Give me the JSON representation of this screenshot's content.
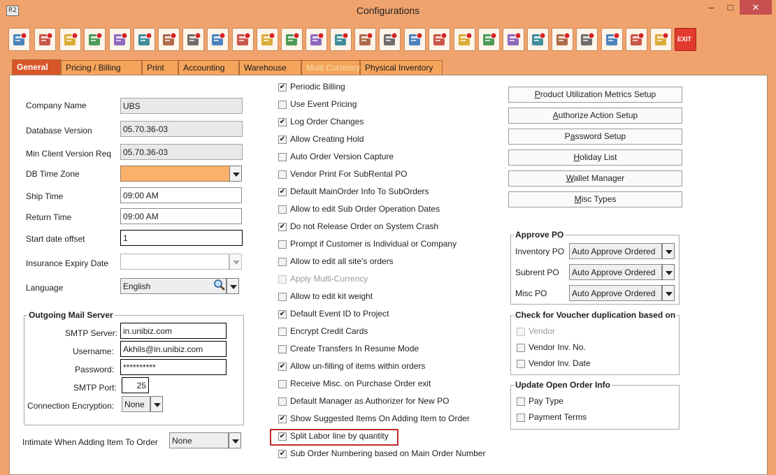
{
  "window": {
    "title": "Configurations",
    "app_icon_text": "R2",
    "minimize": "–",
    "maximize": "□",
    "close": "✕"
  },
  "toolbar": {
    "icons": [
      "save-icon",
      "shipment-icon",
      "money-stack-icon",
      "cash-bill-icon",
      "edit-form-icon",
      "document-alert-icon",
      "price-tag-icon",
      "grid-table-icon",
      "ledger-icon",
      "transfer-icon",
      "calendar-icon",
      "ruler-triangle-icon",
      "gear-icon",
      "color-balls-icon",
      "gear-settings-icon",
      "check-folder-icon",
      "card-reader-icon",
      "doc-export-icon",
      "doc-import-icon",
      "shield-user-icon",
      "shield-lock-icon",
      "gear-cog-icon",
      "document-pages-icon",
      "user-config-icon",
      "folder-settings-icon",
      "form-gear-icon",
      "switch-icon",
      "exit-icon"
    ],
    "exit_label": "EXIT"
  },
  "tabs": [
    {
      "label": "General",
      "state": "active"
    },
    {
      "label": "Pricing / Billing",
      "state": "normal"
    },
    {
      "label": "Print",
      "state": "normal"
    },
    {
      "label": "Accounting",
      "state": "normal"
    },
    {
      "label": "Warehouse",
      "state": "normal"
    },
    {
      "label": "Multi Currency",
      "state": "disabled"
    },
    {
      "label": "Physical Inventory",
      "state": "normal"
    }
  ],
  "general": {
    "company_name_label": "Company Name",
    "company_name": "UBS",
    "database_version_label": "Database Version",
    "database_version": "05.70.36-03",
    "min_client_version_label": "Min Client Version Req",
    "min_client_version": "05.70.36-03",
    "db_time_zone_label": "DB Time Zone",
    "db_time_zone": "",
    "ship_time_label": "Ship Time",
    "ship_time": "09:00 AM",
    "return_time_label": "Return Time",
    "return_time": "09:00 AM",
    "start_date_offset_label": "Start date offset",
    "start_date_offset": "1",
    "insurance_expiry_label": "Insurance Expiry Date",
    "insurance_expiry": "",
    "language_label": "Language",
    "language": "English"
  },
  "mail_server": {
    "title": "Outgoing Mail Server",
    "smtp_server_label": "SMTP Server:",
    "smtp_server": "in.unibiz.com",
    "username_label": "Username:",
    "username": "Akhils@in.unibiz.com",
    "password_label": "Password:",
    "password": "**********",
    "smtp_port_label": "SMTP Port:",
    "smtp_port": "25",
    "encryption_label": "Connection Encryption:",
    "encryption": "None"
  },
  "intimate": {
    "label": "Intimate When Adding Item To Order",
    "value": "None"
  },
  "options": [
    {
      "label": "Periodic Billing",
      "checked": true,
      "disabled": false
    },
    {
      "label": "Use Event Pricing",
      "checked": false,
      "disabled": false
    },
    {
      "label": "Log Order Changes",
      "checked": true,
      "disabled": false
    },
    {
      "label": "Allow Creating Hold",
      "checked": true,
      "disabled": false
    },
    {
      "label": "Auto Order Version Capture",
      "checked": false,
      "disabled": false
    },
    {
      "label": "Vendor Print For SubRental PO",
      "checked": false,
      "disabled": false
    },
    {
      "label": "Default MainOrder Info To SubOrders",
      "checked": true,
      "disabled": false
    },
    {
      "label": "Allow to edit Sub Order Operation Dates",
      "checked": false,
      "disabled": false
    },
    {
      "label": "Do not Release Order on System Crash",
      "checked": true,
      "disabled": false
    },
    {
      "label": "Prompt if Customer is Individual or Company",
      "checked": false,
      "disabled": false
    },
    {
      "label": "Allow to edit all site's orders",
      "checked": false,
      "disabled": false
    },
    {
      "label": "Apply Multi-Currency",
      "checked": false,
      "disabled": true
    },
    {
      "label": "Allow to edit kit weight",
      "checked": false,
      "disabled": false
    },
    {
      "label": "Default Event ID to Project",
      "checked": true,
      "disabled": false
    },
    {
      "label": "Encrypt Credit Cards",
      "checked": false,
      "disabled": false
    },
    {
      "label": "Create Transfers In Resume Mode",
      "checked": false,
      "disabled": false
    },
    {
      "label": "Allow un-filling of items within orders",
      "checked": true,
      "disabled": false
    },
    {
      "label": "Receive Misc. on Purchase Order exit",
      "checked": false,
      "disabled": false
    },
    {
      "label": "Default Manager as Authorizer for New PO",
      "checked": false,
      "disabled": false
    },
    {
      "label": "Show Suggested Items On Adding Item to Order",
      "checked": true,
      "disabled": false
    },
    {
      "label": "Split Labor line by quantity",
      "checked": true,
      "disabled": false
    },
    {
      "label": "Sub Order Numbering based on Main Order Number",
      "checked": true,
      "disabled": false
    }
  ],
  "setup_buttons": [
    {
      "pre": "",
      "u": "P",
      "post": "roduct Utilization Metrics Setup"
    },
    {
      "pre": "",
      "u": "A",
      "post": "uthorize Action Setup"
    },
    {
      "pre": "P",
      "u": "a",
      "post": "ssword Setup"
    },
    {
      "pre": "",
      "u": "H",
      "post": "oliday List"
    },
    {
      "pre": "",
      "u": "W",
      "post": "allet Manager"
    },
    {
      "pre": "",
      "u": "M",
      "post": "isc Types"
    }
  ],
  "approve_po": {
    "title": "Approve PO",
    "inventory_label": "Inventory PO",
    "inventory_value": "Auto Approve Ordered",
    "subrent_label": "Subrent PO",
    "subrent_value": "Auto Approve Ordered",
    "misc_label": "Misc PO",
    "misc_value": "Auto Approve Ordered"
  },
  "voucher_dup": {
    "title": "Check for Voucher duplication based on",
    "items": [
      {
        "label": "Vendor",
        "checked": false,
        "disabled": true
      },
      {
        "label": "Vendor Inv. No.",
        "checked": false,
        "disabled": false
      },
      {
        "label": "Vendor Inv. Date",
        "checked": false,
        "disabled": false
      }
    ]
  },
  "update_open_order": {
    "title": "Update Open Order Info",
    "items": [
      {
        "label": "Pay Type",
        "checked": false,
        "disabled": false
      },
      {
        "label": "Payment Terms",
        "checked": false,
        "disabled": false
      }
    ]
  },
  "colors": {
    "window_bg": "#f0a36d",
    "tab_active": "#d9552a",
    "tab_normal": "#f5a45c",
    "timezone_fill": "#fbb06c",
    "highlight_border": "#c42a2a"
  }
}
